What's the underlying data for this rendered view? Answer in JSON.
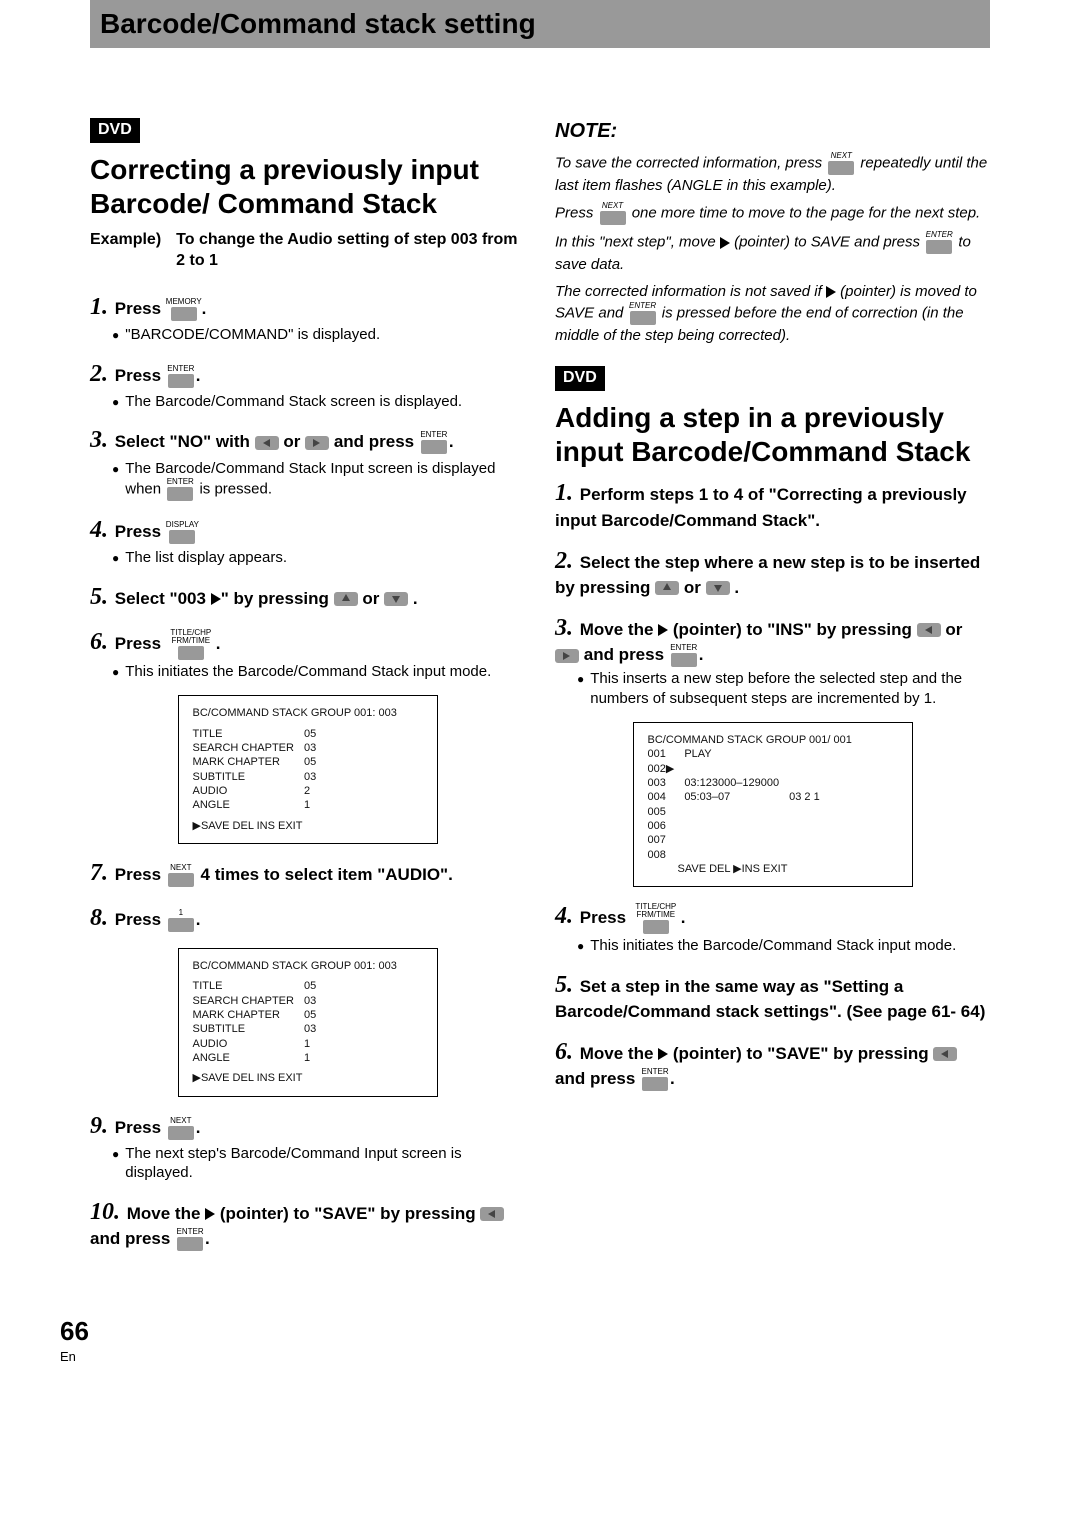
{
  "titlebar": "Barcode/Command stack setting",
  "dvd_label": "DVD",
  "left": {
    "heading": "Correcting a previously input Barcode/ Command Stack",
    "example_label": "Example)",
    "example_text": "To change the Audio setting of step 003 from 2 to 1",
    "steps": {
      "1": {
        "text": "Press",
        "key": "MEMORY",
        "bullet": "\"BARCODE/COMMAND\" is displayed."
      },
      "2": {
        "text": "Press",
        "key": "ENTER",
        "bullet": "The Barcode/Command Stack screen is displayed."
      },
      "3": {
        "text_a": "Select \"NO\" with",
        "text_b": "or",
        "text_c": "and press",
        "key": "ENTER",
        "bullet_a": "The Barcode/Command Stack Input screen is displayed when",
        "bullet_b": "is pressed.",
        "bullet_key": "ENTER"
      },
      "4": {
        "text": "Press",
        "key": "DISPLAY",
        "bullet": "The list display appears."
      },
      "5": {
        "text_a": "Select \"003",
        "text_b": "\" by pressing",
        "text_c": "or",
        "period": "."
      },
      "6": {
        "text": "Press",
        "key": "TITLE/CHP FRM/TIME",
        "bullet": "This initiates the Barcode/Command Stack input mode."
      },
      "7": {
        "text_a": "Press",
        "key": "NEXT",
        "text_b": "4 times to select item \"AUDIO\"."
      },
      "8": {
        "text": "Press",
        "key": "1"
      },
      "9": {
        "text": "Press",
        "key": "NEXT",
        "bullet": "The next step's Barcode/Command Input screen is displayed."
      },
      "10": {
        "text_a": "Move the",
        "text_b": "(pointer) to \"SAVE\" by pressing",
        "text_c": "and press",
        "key": "ENTER"
      }
    }
  },
  "note": {
    "head": "NOTE:",
    "lines": {
      "l1a": "To save the corrected information, press",
      "l1b": "repeatedly until the last item flashes (ANGLE in this example).",
      "l1key": "NEXT",
      "l2a": "Press",
      "l2b": "one more time to move to the page for the next step.",
      "l2key": "NEXT",
      "l3a": "In this \"next step\", move",
      "l3b": "(pointer) to SAVE and press",
      "l3c": "to save data.",
      "l3key": "ENTER",
      "l4a": "The corrected information is not saved if",
      "l4b": "(pointer) is moved to SAVE and",
      "l4c": "is pressed before the end of correction (in the middle of the step being corrected).",
      "l4key": "ENTER"
    }
  },
  "right": {
    "heading": "Adding a step in a previously input Barcode/Command Stack",
    "steps": {
      "1": {
        "text": "Perform steps 1 to 4 of \"Correcting a previously input Barcode/Command Stack\"."
      },
      "2": {
        "text_a": "Select the step where a new step is to be inserted by pressing",
        "text_b": "or",
        "period": "."
      },
      "3": {
        "text_a": "Move the",
        "text_b": "(pointer) to \"INS\" by pressing",
        "text_c": "or",
        "text_d": "and press",
        "key": "ENTER",
        "bullet": "This inserts a new step before the selected step and the numbers of subsequent steps are incremented by 1."
      },
      "4": {
        "text": "Press",
        "key": "TITLE/CHP FRM/TIME",
        "bullet": "This initiates the Barcode/Command Stack input mode."
      },
      "5": {
        "text": "Set a step in the same way as \"Setting a Barcode/Command stack settings\". (See page 61- 64)"
      },
      "6": {
        "text_a": "Move the",
        "text_b": "(pointer) to \"SAVE\" by pressing",
        "text_c": "and press",
        "key": "ENTER"
      }
    }
  },
  "screen1": {
    "header": "BC/COMMAND STACK  GROUP  001: 003",
    "rows": [
      [
        "TITLE",
        "05"
      ],
      [
        "SEARCH  CHAPTER",
        "03"
      ],
      [
        "MARK      CHAPTER",
        "05"
      ],
      [
        "SUBTITLE",
        "03"
      ],
      [
        "AUDIO",
        "2"
      ],
      [
        "ANGLE",
        "1"
      ]
    ],
    "footer": "▶SAVE    DEL      INS      EXIT"
  },
  "screen2": {
    "header": "BC/COMMAND STACK  GROUP  001: 003",
    "rows": [
      [
        "TITLE",
        "05"
      ],
      [
        "SEARCH  CHAPTER",
        "03"
      ],
      [
        "MARK      CHAPTER",
        "05"
      ],
      [
        "SUBTITLE",
        "03"
      ],
      [
        "AUDIO",
        "1"
      ],
      [
        "ANGLE",
        "1"
      ]
    ],
    "footer": "▶SAVE    DEL      INS      EXIT"
  },
  "screen3": {
    "header": "BC/COMMAND STACK  GROUP  001/ 001",
    "rows": [
      [
        "001",
        "PLAY",
        ""
      ],
      [
        "002▶",
        "",
        ""
      ],
      [
        "003",
        "03:123000–129000",
        ""
      ],
      [
        "004",
        "05:03–07",
        "03  2  1"
      ],
      [
        "005",
        "",
        ""
      ],
      [
        "006",
        "",
        ""
      ],
      [
        "007",
        "",
        ""
      ],
      [
        "008",
        "",
        ""
      ]
    ],
    "footer": "SAVE    DEL    ▶INS      EXIT"
  },
  "page_number": "66",
  "page_lang": "En"
}
